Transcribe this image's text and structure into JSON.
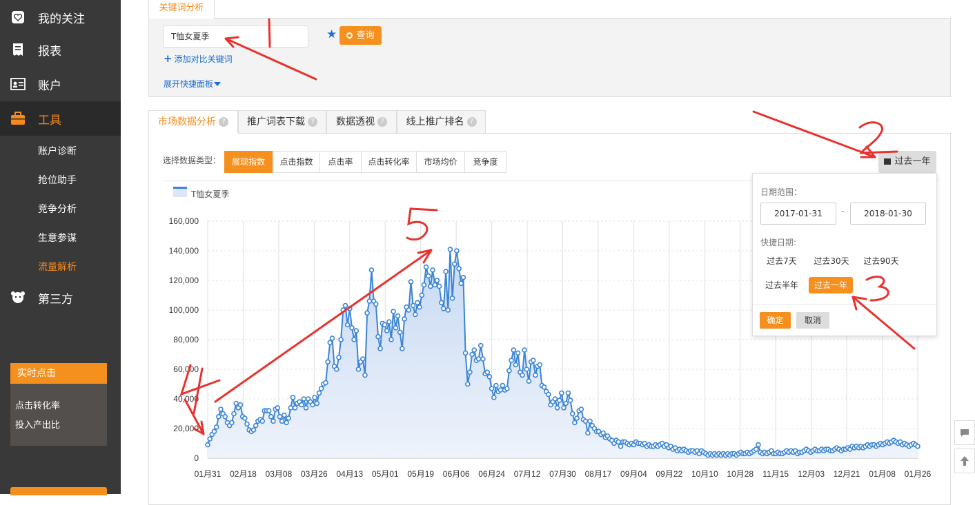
{
  "sidebar": {
    "items": [
      {
        "label": "我的关注",
        "icon": "heart-icon"
      },
      {
        "label": "报表",
        "icon": "report-icon"
      },
      {
        "label": "账户",
        "icon": "account-card-icon"
      },
      {
        "label": "工具",
        "icon": "toolbox-icon"
      },
      {
        "label": "第三方",
        "icon": "third-party-icon"
      }
    ],
    "tool_subitems": [
      "账户诊断",
      "抢位助手",
      "竞争分析",
      "生意参谋",
      "流量解析"
    ],
    "active_item": "工具",
    "active_subitem": "流量解析",
    "realtime": {
      "title": "实时点击",
      "items": [
        "点击转化率",
        "投入产出比"
      ]
    }
  },
  "keyword_panel": {
    "tab_label": "关键词分析",
    "keyword_value": "T恤女夏季",
    "star_icon": "star-icon",
    "query_label": "查询",
    "add_compare_label": "添加对比关键词",
    "expand_label": "展开快捷面板"
  },
  "tabs": [
    {
      "label": "市场数据分析",
      "active": true
    },
    {
      "label": "推广词表下载",
      "active": false
    },
    {
      "label": "数据透视",
      "active": false
    },
    {
      "label": "线上推广排名",
      "active": false
    }
  ],
  "data_type": {
    "label": "选择数据类型：",
    "options": [
      "展现指数",
      "点击指数",
      "点击率",
      "点击转化率",
      "市场均价",
      "竞争度"
    ],
    "selected": "展现指数"
  },
  "date_button_label": "过去一年",
  "date_popup": {
    "range_label": "日期范围：",
    "start": "2017-01-31",
    "end": "2018-01-30",
    "dash": "-",
    "quick_label": "快捷日期:",
    "quick_options": [
      "过去7天",
      "过去30天",
      "过去90天",
      "过去半年",
      "过去一年"
    ],
    "quick_selected": "过去一年",
    "ok_label": "确定",
    "cancel_label": "取消"
  },
  "colors": {
    "accent": "#f5901f",
    "sidebar_bg": "#3a3939",
    "link": "#1c6ed4",
    "series": "#3b84d8",
    "annotation": "#e8322e"
  },
  "chart_data": {
    "type": "area",
    "series": [
      {
        "name": "T恤女夏季"
      }
    ],
    "ylim": [
      0,
      160000
    ],
    "y_ticks": [
      "0",
      "20,000",
      "40,000",
      "60,000",
      "80,000",
      "100,000",
      "120,000",
      "140,000",
      "160,000"
    ],
    "x_ticks": [
      "01月31",
      "02月18",
      "03月08",
      "03月26",
      "04月13",
      "05月01",
      "05月19",
      "06月06",
      "06月24",
      "07月12",
      "07月30",
      "08月17",
      "09月04",
      "09月22",
      "10月10",
      "10月28",
      "11月15",
      "12月03",
      "12月21",
      "01月08",
      "01月26"
    ],
    "grid": true,
    "points": [
      [
        0,
        9000
      ],
      [
        1,
        13000
      ],
      [
        2,
        16000
      ],
      [
        3,
        18000
      ],
      [
        4,
        21000
      ],
      [
        5,
        28000
      ],
      [
        6,
        33000
      ],
      [
        7,
        30000
      ],
      [
        8,
        28000
      ],
      [
        9,
        24000
      ],
      [
        10,
        22000
      ],
      [
        11,
        24000
      ],
      [
        12,
        30000
      ],
      [
        13,
        37000
      ],
      [
        14,
        34000
      ],
      [
        15,
        36000
      ],
      [
        16,
        28000
      ],
      [
        17,
        27000
      ],
      [
        18,
        23000
      ],
      [
        19,
        19000
      ],
      [
        20,
        18000
      ],
      [
        21,
        19000
      ],
      [
        22,
        22000
      ],
      [
        23,
        25000
      ],
      [
        24,
        26000
      ],
      [
        25,
        25000
      ],
      [
        26,
        32000
      ],
      [
        27,
        32000
      ],
      [
        28,
        32000
      ],
      [
        29,
        28000
      ],
      [
        30,
        25000
      ],
      [
        31,
        33000
      ],
      [
        32,
        34000
      ],
      [
        33,
        28000
      ],
      [
        34,
        25000
      ],
      [
        35,
        29000
      ],
      [
        36,
        24000
      ],
      [
        37,
        27000
      ],
      [
        38,
        34000
      ],
      [
        39,
        41000
      ],
      [
        40,
        34000
      ],
      [
        41,
        37000
      ],
      [
        42,
        38000
      ],
      [
        43,
        36000
      ],
      [
        44,
        40000
      ],
      [
        45,
        34000
      ],
      [
        46,
        40000
      ],
      [
        47,
        38000
      ],
      [
        48,
        36000
      ],
      [
        49,
        41000
      ],
      [
        50,
        37000
      ],
      [
        51,
        44000
      ],
      [
        52,
        47000
      ],
      [
        53,
        50000
      ],
      [
        54,
        51000
      ],
      [
        55,
        65000
      ],
      [
        56,
        78000
      ],
      [
        57,
        81000
      ],
      [
        58,
        62000
      ],
      [
        59,
        60000
      ],
      [
        60,
        68000
      ],
      [
        61,
        80000
      ],
      [
        62,
        100000
      ],
      [
        63,
        103000
      ],
      [
        64,
        90000
      ],
      [
        65,
        101000
      ],
      [
        66,
        88000
      ],
      [
        67,
        80000
      ],
      [
        68,
        86000
      ],
      [
        69,
        60000
      ],
      [
        70,
        65000
      ],
      [
        71,
        67000
      ],
      [
        72,
        56000
      ],
      [
        73,
        98000
      ],
      [
        74,
        106000
      ],
      [
        75,
        127000
      ],
      [
        76,
        106000
      ],
      [
        77,
        104000
      ],
      [
        78,
        82000
      ],
      [
        79,
        74000
      ],
      [
        80,
        91000
      ],
      [
        81,
        90000
      ],
      [
        82,
        86000
      ],
      [
        83,
        92000
      ],
      [
        84,
        80000
      ],
      [
        85,
        99000
      ],
      [
        86,
        88000
      ],
      [
        87,
        96000
      ],
      [
        88,
        85000
      ],
      [
        89,
        74000
      ],
      [
        90,
        94000
      ],
      [
        91,
        102000
      ],
      [
        92,
        100000
      ],
      [
        93,
        119000
      ],
      [
        94,
        103000
      ],
      [
        95,
        97000
      ],
      [
        96,
        105000
      ],
      [
        97,
        102000
      ],
      [
        98,
        110000
      ],
      [
        99,
        117000
      ],
      [
        100,
        129000
      ],
      [
        101,
        123000
      ],
      [
        102,
        116000
      ],
      [
        103,
        127000
      ],
      [
        104,
        117000
      ],
      [
        105,
        120000
      ],
      [
        106,
        116000
      ],
      [
        107,
        105000
      ],
      [
        108,
        101000
      ],
      [
        109,
        126000
      ],
      [
        110,
        100000
      ],
      [
        111,
        141000
      ],
      [
        112,
        108000
      ],
      [
        113,
        131000
      ],
      [
        114,
        140000
      ],
      [
        115,
        128000
      ],
      [
        116,
        118000
      ],
      [
        117,
        122000
      ],
      [
        118,
        71000
      ],
      [
        119,
        50000
      ],
      [
        120,
        58000
      ],
      [
        121,
        70000
      ],
      [
        122,
        73000
      ],
      [
        123,
        66000
      ],
      [
        124,
        67000
      ],
      [
        125,
        76000
      ],
      [
        126,
        67000
      ],
      [
        127,
        57000
      ],
      [
        128,
        58000
      ],
      [
        129,
        55000
      ],
      [
        130,
        47000
      ],
      [
        131,
        41000
      ],
      [
        132,
        49000
      ],
      [
        133,
        45000
      ],
      [
        134,
        46000
      ],
      [
        135,
        49000
      ],
      [
        136,
        46000
      ],
      [
        137,
        47000
      ],
      [
        138,
        59000
      ],
      [
        139,
        66000
      ],
      [
        140,
        73000
      ],
      [
        141,
        63000
      ],
      [
        142,
        71000
      ],
      [
        143,
        58000
      ],
      [
        144,
        56000
      ],
      [
        145,
        73000
      ],
      [
        146,
        60000
      ],
      [
        147,
        52000
      ],
      [
        148,
        65000
      ],
      [
        149,
        66000
      ],
      [
        150,
        56000
      ],
      [
        151,
        62000
      ],
      [
        152,
        63000
      ],
      [
        153,
        49000
      ],
      [
        154,
        48000
      ],
      [
        155,
        45000
      ],
      [
        156,
        43000
      ],
      [
        157,
        36000
      ],
      [
        158,
        38000
      ],
      [
        159,
        40000
      ],
      [
        160,
        34000
      ],
      [
        161,
        39000
      ],
      [
        162,
        44000
      ],
      [
        163,
        34000
      ],
      [
        164,
        37000
      ],
      [
        165,
        44000
      ],
      [
        166,
        39000
      ],
      [
        167,
        30000
      ],
      [
        168,
        24000
      ],
      [
        169,
        27000
      ],
      [
        170,
        32000
      ],
      [
        171,
        33000
      ],
      [
        172,
        26000
      ],
      [
        173,
        25000
      ],
      [
        174,
        17000
      ],
      [
        175,
        25000
      ],
      [
        176,
        22000
      ],
      [
        177,
        20000
      ],
      [
        178,
        18000
      ],
      [
        179,
        18000
      ],
      [
        180,
        16000
      ],
      [
        181,
        17000
      ],
      [
        182,
        14000
      ],
      [
        183,
        15000
      ],
      [
        184,
        13000
      ],
      [
        185,
        12000
      ],
      [
        186,
        10000
      ],
      [
        187,
        12000
      ],
      [
        188,
        11000
      ],
      [
        189,
        8000
      ],
      [
        190,
        11000
      ],
      [
        191,
        11000
      ],
      [
        192,
        10000
      ],
      [
        193,
        9000
      ],
      [
        194,
        10000
      ],
      [
        195,
        9000
      ],
      [
        196,
        11000
      ],
      [
        197,
        10000
      ],
      [
        198,
        10000
      ],
      [
        199,
        9000
      ],
      [
        200,
        10000
      ],
      [
        201,
        8000
      ],
      [
        202,
        9000
      ],
      [
        203,
        8000
      ],
      [
        204,
        8000
      ],
      [
        205,
        9000
      ],
      [
        206,
        8000
      ],
      [
        207,
        9000
      ],
      [
        208,
        10000
      ],
      [
        209,
        8000
      ],
      [
        210,
        9000
      ],
      [
        211,
        7000
      ],
      [
        212,
        8000
      ],
      [
        213,
        6000
      ],
      [
        214,
        7000
      ],
      [
        215,
        5000
      ],
      [
        216,
        6000
      ],
      [
        217,
        5000
      ],
      [
        218,
        6000
      ],
      [
        219,
        5000
      ],
      [
        220,
        4000
      ],
      [
        221,
        5000
      ],
      [
        222,
        5000
      ],
      [
        223,
        4000
      ],
      [
        224,
        5000
      ],
      [
        225,
        3000
      ],
      [
        226,
        5000
      ],
      [
        227,
        4000
      ],
      [
        228,
        3000
      ],
      [
        229,
        2000
      ],
      [
        230,
        3000
      ],
      [
        231,
        2000
      ],
      [
        232,
        3000
      ],
      [
        233,
        2000
      ],
      [
        234,
        3000
      ],
      [
        235,
        2000
      ],
      [
        236,
        3000
      ],
      [
        237,
        2000
      ],
      [
        238,
        3000
      ],
      [
        239,
        2000
      ],
      [
        240,
        3000
      ],
      [
        241,
        3000
      ],
      [
        242,
        2000
      ],
      [
        243,
        3000
      ],
      [
        244,
        4000
      ],
      [
        245,
        3000
      ],
      [
        246,
        3000
      ],
      [
        247,
        4000
      ],
      [
        248,
        3000
      ],
      [
        249,
        4000
      ],
      [
        250,
        5000
      ],
      [
        251,
        6000
      ],
      [
        252,
        9000
      ],
      [
        253,
        4000
      ],
      [
        254,
        3000
      ],
      [
        255,
        4000
      ],
      [
        256,
        3000
      ],
      [
        257,
        4000
      ],
      [
        258,
        5000
      ],
      [
        259,
        3000
      ],
      [
        260,
        3000
      ],
      [
        261,
        4000
      ],
      [
        262,
        3000
      ],
      [
        263,
        3000
      ],
      [
        264,
        4000
      ],
      [
        265,
        5000
      ],
      [
        266,
        4000
      ],
      [
        267,
        5000
      ],
      [
        268,
        4000
      ],
      [
        269,
        5000
      ],
      [
        270,
        3000
      ],
      [
        271,
        4000
      ],
      [
        272,
        4000
      ],
      [
        273,
        5000
      ],
      [
        274,
        6000
      ],
      [
        275,
        5000
      ],
      [
        276,
        4000
      ],
      [
        277,
        5000
      ],
      [
        278,
        6000
      ],
      [
        279,
        5000
      ],
      [
        280,
        5000
      ],
      [
        281,
        6000
      ],
      [
        282,
        5000
      ],
      [
        283,
        6000
      ],
      [
        284,
        6000
      ],
      [
        285,
        5000
      ],
      [
        286,
        5000
      ],
      [
        287,
        6000
      ],
      [
        288,
        7000
      ],
      [
        289,
        6000
      ],
      [
        290,
        5000
      ],
      [
        291,
        6000
      ],
      [
        292,
        6000
      ],
      [
        293,
        7000
      ],
      [
        294,
        6000
      ],
      [
        295,
        8000
      ],
      [
        296,
        7000
      ],
      [
        297,
        8000
      ],
      [
        298,
        7000
      ],
      [
        299,
        8000
      ],
      [
        300,
        7000
      ],
      [
        301,
        8000
      ],
      [
        302,
        9000
      ],
      [
        303,
        8000
      ],
      [
        304,
        9000
      ],
      [
        305,
        9000
      ],
      [
        306,
        8000
      ],
      [
        307,
        9000
      ],
      [
        308,
        10000
      ],
      [
        309,
        9000
      ],
      [
        310,
        10000
      ],
      [
        311,
        11000
      ],
      [
        312,
        10000
      ],
      [
        313,
        11000
      ],
      [
        314,
        12000
      ],
      [
        315,
        11000
      ],
      [
        316,
        10000
      ],
      [
        317,
        11000
      ],
      [
        318,
        9000
      ],
      [
        319,
        10000
      ],
      [
        320,
        9000
      ],
      [
        321,
        8000
      ],
      [
        322,
        9000
      ],
      [
        323,
        10000
      ],
      [
        324,
        9000
      ],
      [
        325,
        8000
      ]
    ]
  },
  "side_tools": [
    "feedback-icon",
    "back-to-top-icon"
  ],
  "annotations": [
    "1",
    "2",
    "3",
    "4",
    "5"
  ]
}
